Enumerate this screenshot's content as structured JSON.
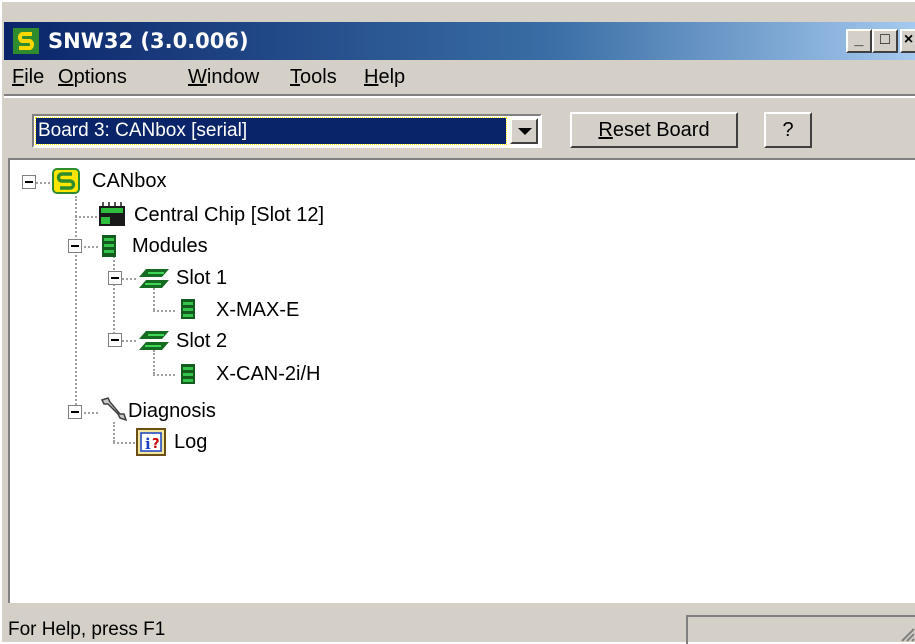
{
  "window": {
    "title": "SNW32 (3.0.006)",
    "controls": {
      "minimize": "_",
      "maximize": "□",
      "close": "×"
    }
  },
  "menu": [
    {
      "mnemonic": "F",
      "rest": "ile"
    },
    {
      "mnemonic": "O",
      "rest": "ptions"
    },
    {
      "mnemonic": "W",
      "rest": "indow"
    },
    {
      "mnemonic": "T",
      "rest": "ools"
    },
    {
      "mnemonic": "H",
      "rest": "elp"
    }
  ],
  "toolbar": {
    "board_select_value": "Board 3: CANbox [serial]",
    "reset_mnemonic": "R",
    "reset_rest": "eset Board",
    "help_label": "?"
  },
  "tree": {
    "root": "CANbox",
    "central_chip": "Central Chip [Slot 12]",
    "modules": "Modules",
    "slot1": "Slot 1",
    "slot1_module": "X-MAX-E",
    "slot2": "Slot 2",
    "slot2_module": "X-CAN-2i/H",
    "diagnosis": "Diagnosis",
    "log": "Log"
  },
  "status": {
    "text": "For Help, press F1"
  },
  "colors": {
    "title_active": "#0a246a",
    "selection": "#0a246a",
    "face": "#d4d0c8"
  }
}
